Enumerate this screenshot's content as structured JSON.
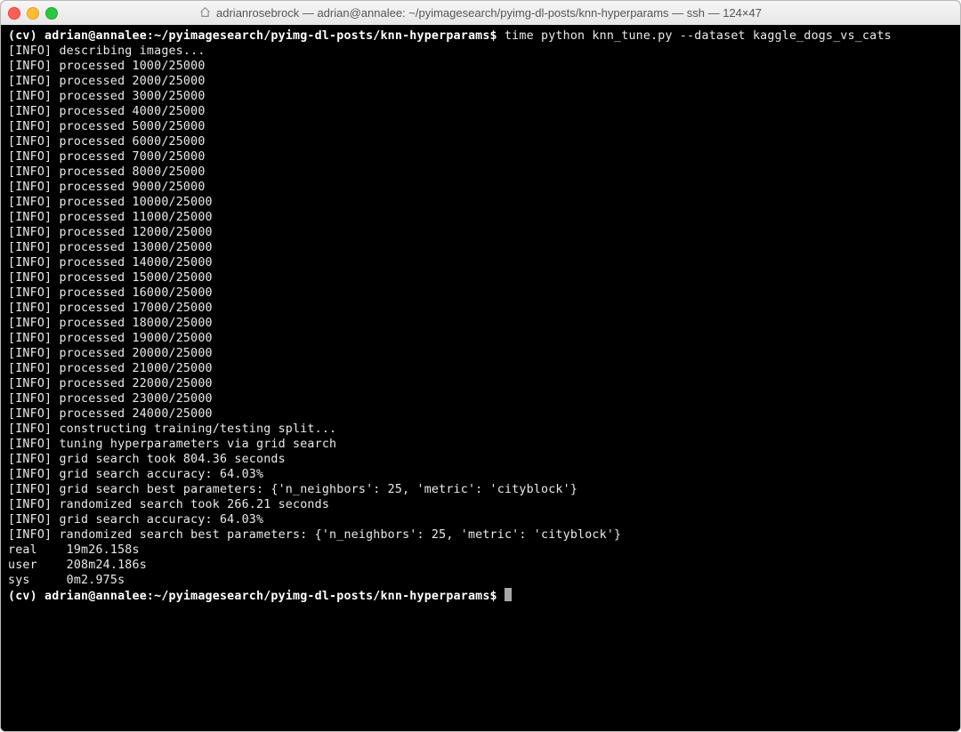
{
  "titlebar": {
    "title": "adrianrosebrock — adrian@annalee: ~/pyimagesearch/pyimg-dl-posts/knn-hyperparams — ssh — 124×47"
  },
  "term": {
    "prompt1": "(cv) adrian@annalee:~/pyimagesearch/pyimg-dl-posts/knn-hyperparams$ ",
    "cmd1": "time python knn_tune.py --dataset kaggle_dogs_vs_cats",
    "info": {
      "describing": "[INFO] describing images...",
      "processed": [
        "[INFO] processed 1000/25000",
        "[INFO] processed 2000/25000",
        "[INFO] processed 3000/25000",
        "[INFO] processed 4000/25000",
        "[INFO] processed 5000/25000",
        "[INFO] processed 6000/25000",
        "[INFO] processed 7000/25000",
        "[INFO] processed 8000/25000",
        "[INFO] processed 9000/25000",
        "[INFO] processed 10000/25000",
        "[INFO] processed 11000/25000",
        "[INFO] processed 12000/25000",
        "[INFO] processed 13000/25000",
        "[INFO] processed 14000/25000",
        "[INFO] processed 15000/25000",
        "[INFO] processed 16000/25000",
        "[INFO] processed 17000/25000",
        "[INFO] processed 18000/25000",
        "[INFO] processed 19000/25000",
        "[INFO] processed 20000/25000",
        "[INFO] processed 21000/25000",
        "[INFO] processed 22000/25000",
        "[INFO] processed 23000/25000",
        "[INFO] processed 24000/25000"
      ],
      "tail": [
        "[INFO] constructing training/testing split...",
        "[INFO] tuning hyperparameters via grid search",
        "[INFO] grid search took 804.36 seconds",
        "[INFO] grid search accuracy: 64.03%",
        "[INFO] grid search best parameters: {'n_neighbors': 25, 'metric': 'cityblock'}",
        "[INFO] randomized search took 266.21 seconds",
        "[INFO] grid search accuracy: 64.03%",
        "[INFO] randomized search best parameters: {'n_neighbors': 25, 'metric': 'cityblock'}"
      ]
    },
    "blank": "",
    "timing": {
      "real": "real    19m26.158s",
      "user": "user    208m24.186s",
      "sys": "sys     0m2.975s"
    },
    "prompt2": "(cv) adrian@annalee:~/pyimagesearch/pyimg-dl-posts/knn-hyperparams$ "
  }
}
